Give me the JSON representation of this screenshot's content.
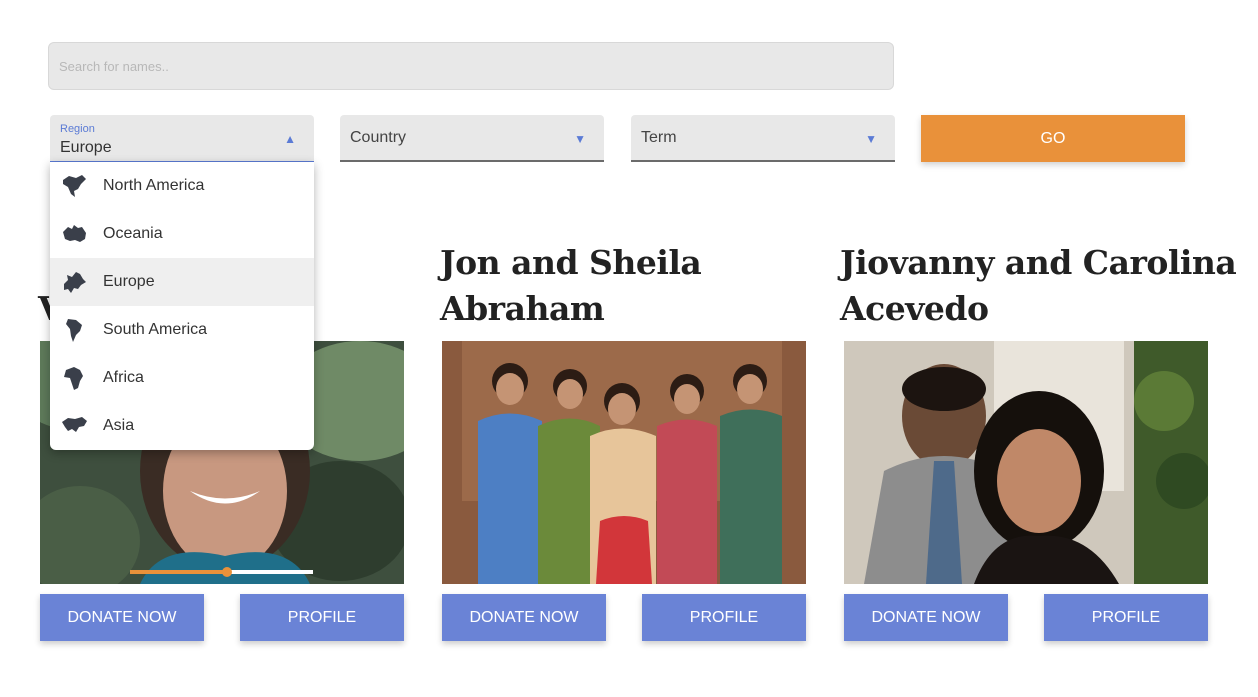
{
  "search": {
    "placeholder": "Search for names.."
  },
  "filters": {
    "region": {
      "label": "Region",
      "value": "Europe"
    },
    "country": {
      "placeholder": "Country"
    },
    "term": {
      "placeholder": "Term"
    },
    "go_label": "GO"
  },
  "region_options": [
    {
      "label": "North America",
      "icon": "north-america-map-icon"
    },
    {
      "label": "Oceania",
      "icon": "oceania-map-icon"
    },
    {
      "label": "Europe",
      "icon": "europe-map-icon",
      "selected": true
    },
    {
      "label": "South America",
      "icon": "south-america-map-icon"
    },
    {
      "label": "Africa",
      "icon": "africa-map-icon"
    },
    {
      "label": "Asia",
      "icon": "asia-map-icon"
    }
  ],
  "cards": [
    {
      "title_fragment": "V",
      "donate_label": "DONATE NOW",
      "profile_label": "PROFILE",
      "video_progress": 0.53
    },
    {
      "title_line1": "Jon and Sheila",
      "title_line2": "Abraham",
      "donate_label": "DONATE NOW",
      "profile_label": "PROFILE"
    },
    {
      "title_line1": "Jiovanny and Carolina",
      "title_line2": "Acevedo",
      "donate_label": "DONATE NOW",
      "profile_label": "PROFILE"
    }
  ],
  "colors": {
    "accent_blue": "#6a83d6",
    "accent_orange": "#e9913a"
  }
}
